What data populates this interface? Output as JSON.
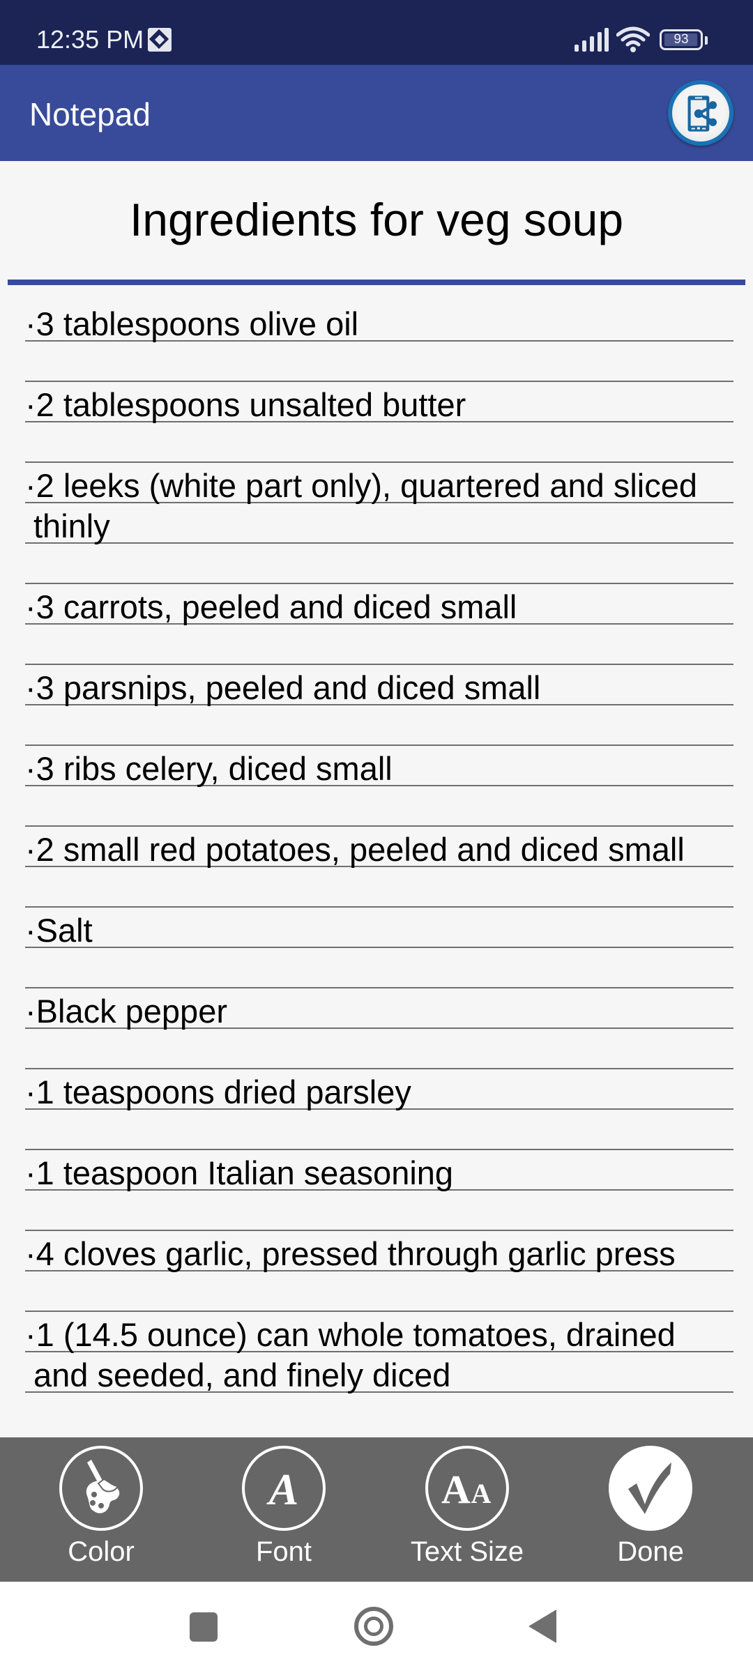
{
  "status_bar": {
    "time": "12:35 PM",
    "notification_icon": "download-manager-icon",
    "signal_icon": "cell-signal-icon",
    "wifi_icon": "wifi-icon",
    "battery_level": 93,
    "battery_text": "93"
  },
  "app_bar": {
    "title": "Notepad",
    "share_icon": "share-device-icon"
  },
  "note": {
    "title": "Ingredients for veg soup",
    "accent_color": "#384b9a",
    "items": [
      "·3 tablespoons olive oil",
      "·2 tablespoons unsalted butter",
      "·2 leeks (white part only), quartered and sliced thinly",
      "·3 carrots, peeled and diced small",
      "·3 parsnips, peeled and diced small",
      "·3 ribs celery, diced small",
      "·2 small red potatoes, peeled and diced small",
      "·Salt",
      "·Black pepper",
      "·1 teaspoons dried parsley",
      "·1 teaspoon Italian seasoning",
      "·4 cloves garlic, pressed through garlic press",
      "·1 (14.5 ounce) can whole tomatoes, drained and seeded, and finely diced"
    ]
  },
  "toolbar": {
    "color_label": "Color",
    "font_label": "Font",
    "text_size_label": "Text Size",
    "done_label": "Done",
    "font_glyph": "A",
    "text_size_glyph_big": "A",
    "text_size_glyph_small": "A"
  },
  "nav_bar": {
    "recents_icon": "square-icon",
    "home_icon": "circle-icon",
    "back_icon": "triangle-back-icon"
  }
}
